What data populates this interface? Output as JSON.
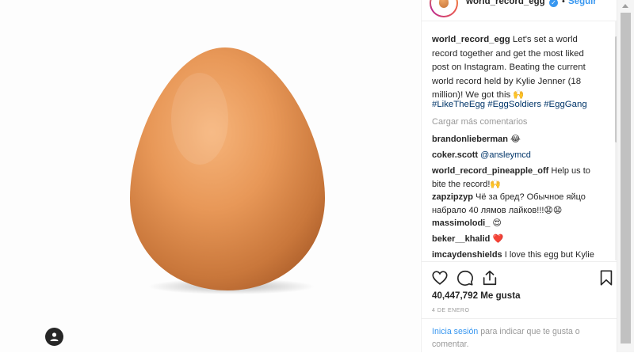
{
  "header": {
    "username": "world_record_egg",
    "verified_glyph": "✓",
    "separator": "•",
    "follow_label": "Seguir"
  },
  "caption": {
    "username": "world_record_egg",
    "text": "Let's set a world record together and get the most liked post on Instagram. Beating the current world record held by Kylie Jenner (18 million)! We got this 🙌",
    "hashtags": "#LikeTheEgg #EggSoldiers #EggGang"
  },
  "load_more": "Cargar más comentarios",
  "comments": [
    {
      "user": "brandonlieberman",
      "text": "😂"
    },
    {
      "user": "coker.scott",
      "text": "@ansleymcd"
    },
    {
      "user": "world_record_pineapple_off",
      "text": "Help us to bite the record!🙌"
    },
    {
      "user": "zapzipzyp",
      "text": "Чё за бред? Обычное яйцо набрало 40 лямов лайков!!!😧😧"
    },
    {
      "user": "massimolodi_",
      "text": "😍"
    },
    {
      "user": "beker__khalid",
      "text": "❤️"
    },
    {
      "user": "imcaydenshields",
      "text": "I love this egg but Kylie is"
    }
  ],
  "likes": {
    "count": "40,447,792",
    "label": "Me gusta"
  },
  "date": "4 DE ENERO",
  "login_prompt": {
    "link": "Inicia sesión",
    "text": "para indicar que te gusta o comentar."
  },
  "icons": {
    "like": "heart-icon",
    "comment": "comment-icon",
    "share": "share-icon",
    "save": "bookmark-icon",
    "user_tag": "user-icon"
  },
  "colors": {
    "link": "#3897f0",
    "hashtag": "#003569",
    "egg": "#e59a5a"
  }
}
